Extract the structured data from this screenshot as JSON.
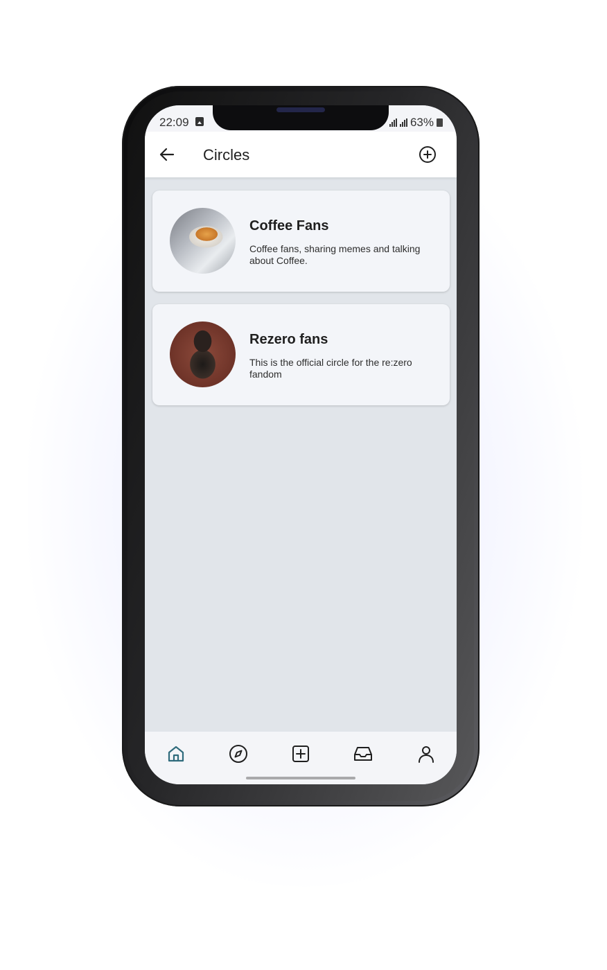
{
  "status_bar": {
    "time": "22:09",
    "battery": "63%",
    "icons": [
      "gallery-icon",
      "signal-icon",
      "signal-icon",
      "battery-icon"
    ]
  },
  "app_bar": {
    "title": "Circles",
    "back_icon": "arrow-left-icon",
    "add_icon": "plus-circle-icon"
  },
  "circles": [
    {
      "name": "Coffee Fans",
      "description": "Coffee fans, sharing memes and talking about Coffee.",
      "avatar": "coffee-cup-photo"
    },
    {
      "name": "Rezero fans",
      "description": "This is the official circle for the re:zero fandom",
      "avatar": "anime-character-photo"
    }
  ],
  "bottom_nav": {
    "items": [
      {
        "icon": "home-icon",
        "active": true
      },
      {
        "icon": "compass-icon",
        "active": false
      },
      {
        "icon": "plus-square-icon",
        "active": false
      },
      {
        "icon": "inbox-icon",
        "active": false
      },
      {
        "icon": "user-icon",
        "active": false
      }
    ]
  },
  "colors": {
    "accent": "#2f6b7c",
    "screen_background": "#e1e5ea",
    "card_background": "#f3f5f9",
    "text": "#1f1f1f"
  }
}
